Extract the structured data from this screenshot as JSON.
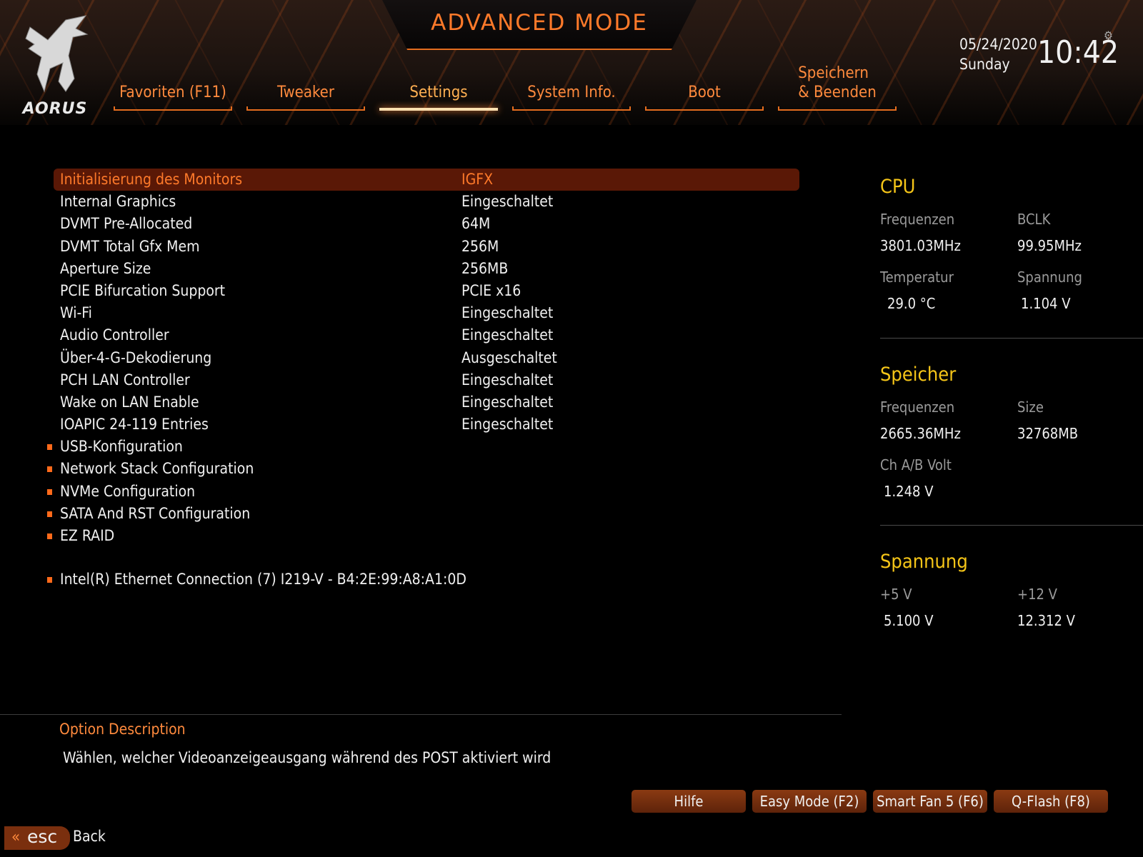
{
  "header": {
    "mode_title": "ADVANCED MODE",
    "logo_text": "AORUS",
    "date": "05/24/2020",
    "day": "Sunday",
    "time": "10:42",
    "tabs": [
      {
        "label": "Favoriten (F11)",
        "active": false
      },
      {
        "label": "Tweaker",
        "active": false
      },
      {
        "label": "Settings",
        "active": true
      },
      {
        "label": "System Info.",
        "active": false
      },
      {
        "label": "Boot",
        "active": false
      },
      {
        "label": "Speichern\n& Beenden",
        "active": false
      }
    ]
  },
  "settings": [
    {
      "label": "Initialisierung des Monitors",
      "value": "IGFX",
      "selected": true
    },
    {
      "label": "Internal Graphics",
      "value": "Eingeschaltet"
    },
    {
      "label": "DVMT Pre-Allocated",
      "value": "64M"
    },
    {
      "label": "DVMT Total Gfx Mem",
      "value": "256M"
    },
    {
      "label": "Aperture Size",
      "value": "256MB"
    },
    {
      "label": "PCIE Bifurcation Support",
      "value": "PCIE x16"
    },
    {
      "label": "Wi-Fi",
      "value": "Eingeschaltet"
    },
    {
      "label": "Audio Controller",
      "value": "Eingeschaltet"
    },
    {
      "label": "Über-4-G-Dekodierung",
      "value": "Ausgeschaltet"
    },
    {
      "label": "PCH LAN Controller",
      "value": "Eingeschaltet"
    },
    {
      "label": "Wake on LAN Enable",
      "value": "Eingeschaltet"
    },
    {
      "label": "IOAPIC 24-119 Entries",
      "value": "Eingeschaltet"
    }
  ],
  "submenus": [
    "USB-Konfiguration",
    "Network Stack Configuration",
    "NVMe Configuration",
    "SATA And RST Configuration",
    "EZ RAID"
  ],
  "ethernet_item": "Intel(R) Ethernet Connection (7) I219-V - B4:2E:99:A8:A1:0D",
  "cpu": {
    "title": "CPU",
    "freq_label": "Frequenzen",
    "freq_value": "3801.03MHz",
    "bclk_label": "BCLK",
    "bclk_value": "99.95MHz",
    "temp_label": "Temperatur",
    "temp_value": "29.0 °C",
    "volt_label": "Spannung",
    "volt_value": "1.104 V"
  },
  "memory": {
    "title": "Speicher",
    "freq_label": "Frequenzen",
    "freq_value": "2665.36MHz",
    "size_label": "Size",
    "size_value": "32768MB",
    "volt_label": "Ch A/B Volt",
    "volt_value": "1.248 V"
  },
  "voltage": {
    "title": "Spannung",
    "v5_label": "+5 V",
    "v5_value": "5.100 V",
    "v12_label": "+12 V",
    "v12_value": "12.312 V"
  },
  "description": {
    "title": "Option Description",
    "text": "Wählen, welcher Videoanzeigeausgang während des POST aktiviert wird"
  },
  "buttons": [
    "Hilfe",
    "Easy Mode (F2)",
    "Smart Fan 5 (F6)",
    "Q-Flash (F8)"
  ],
  "esc": {
    "key": "esc",
    "label": "Back"
  },
  "colors": {
    "accent": "#ff7a2a",
    "section_title": "#f5c518",
    "selected_bg": "#5a1806"
  }
}
